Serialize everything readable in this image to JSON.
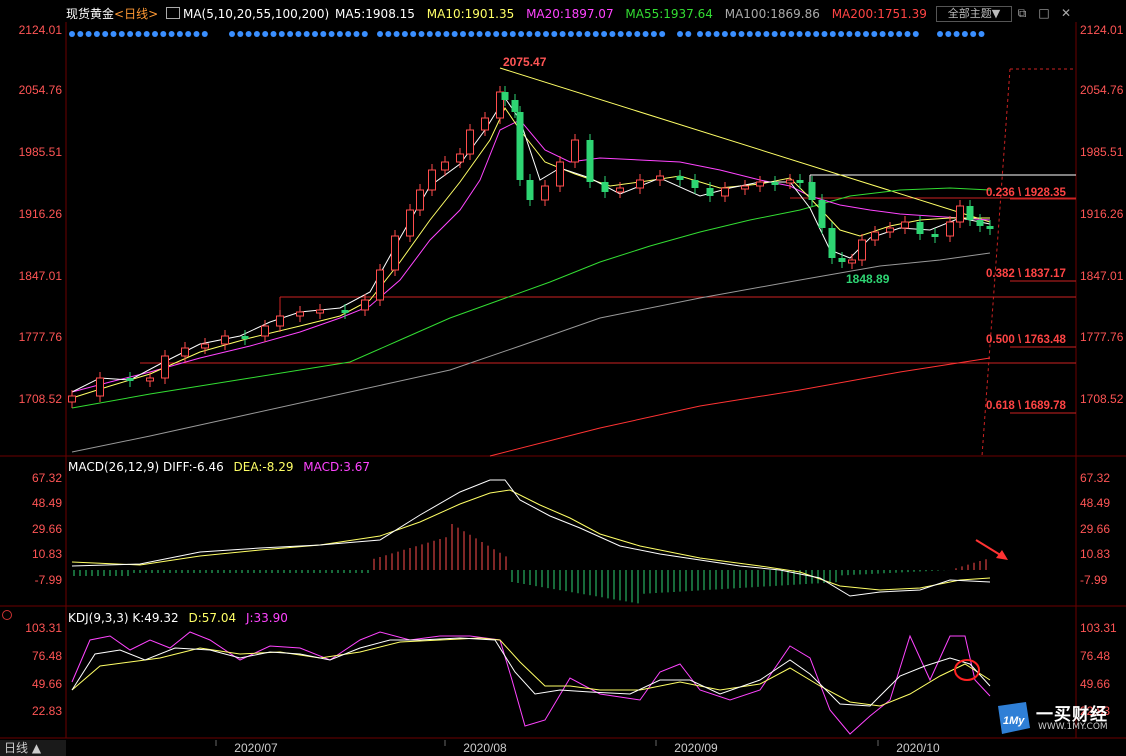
{
  "header": {
    "symbol": "现货黄金",
    "period": "<日线>",
    "ma_def": "MA(5,10,20,55,100,200)",
    "ma5": "MA5:1908.15",
    "ma10": "MA10:1901.35",
    "ma20": "MA20:1897.07",
    "ma55": "MA55:1937.64",
    "ma100": "MA100:1869.86",
    "ma200": "MA200:1751.39",
    "theme_button": "全部主题▼"
  },
  "price_axis": {
    "labels": [
      "2124.01",
      "2054.76",
      "1985.51",
      "1916.26",
      "1847.01",
      "1777.76",
      "1708.52"
    ]
  },
  "annotations": {
    "high": "2075.47",
    "low": "1848.89",
    "fib_236": "0.236 \\ 1928.35",
    "fib_382": "0.382 \\ 1837.17",
    "fib_500": "0.500 \\ 1763.48",
    "fib_618": "0.618 \\ 1689.78"
  },
  "macd": {
    "title": "MACD(26,12,9)",
    "diff": "DIFF:-6.46",
    "dea": "DEA:-8.29",
    "macd": "MACD:3.67",
    "labels": [
      "67.32",
      "48.49",
      "29.66",
      "10.83",
      "-7.99"
    ]
  },
  "kdj": {
    "title": "KDJ(9,3,3)",
    "k": "K:49.32",
    "d": "D:57.04",
    "j": "J:33.90",
    "labels": [
      "103.31",
      "76.48",
      "49.66",
      "22.83"
    ]
  },
  "time_axis": {
    "labels": [
      "2020/07",
      "2020/08",
      "2020/09",
      "2020/10"
    ]
  },
  "footer": {
    "period_button": "日线 ▲",
    "logo_text": "一买财经",
    "logo_url": "WWW.1MY.COM"
  },
  "colors": {
    "up": "#ff4d4d",
    "down": "#2ed573",
    "ma5": "#ffffff",
    "ma10": "#ffff66",
    "ma20": "#ff44ff",
    "ma55": "#33dd33",
    "ma100": "#999999",
    "ma200": "#ff3333"
  }
}
